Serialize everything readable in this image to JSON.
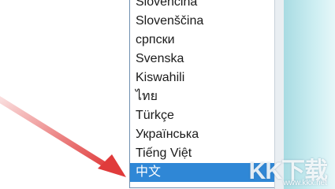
{
  "language_list": {
    "items": [
      {
        "label": "Slovenčina",
        "selected": false
      },
      {
        "label": "Slovenščina",
        "selected": false
      },
      {
        "label": "српски",
        "selected": false
      },
      {
        "label": "Svenska",
        "selected": false
      },
      {
        "label": "Kiswahili",
        "selected": false
      },
      {
        "label": "ไทย",
        "selected": false
      },
      {
        "label": "Türkçe",
        "selected": false
      },
      {
        "label": "Українська",
        "selected": false
      },
      {
        "label": "Tiếng Việt",
        "selected": false
      },
      {
        "label": "中文",
        "selected": true
      }
    ]
  },
  "annotation": {
    "arrow_color": "#e03b3b"
  },
  "watermark": {
    "logo": "KK下载",
    "url": "www.kkx.net"
  }
}
